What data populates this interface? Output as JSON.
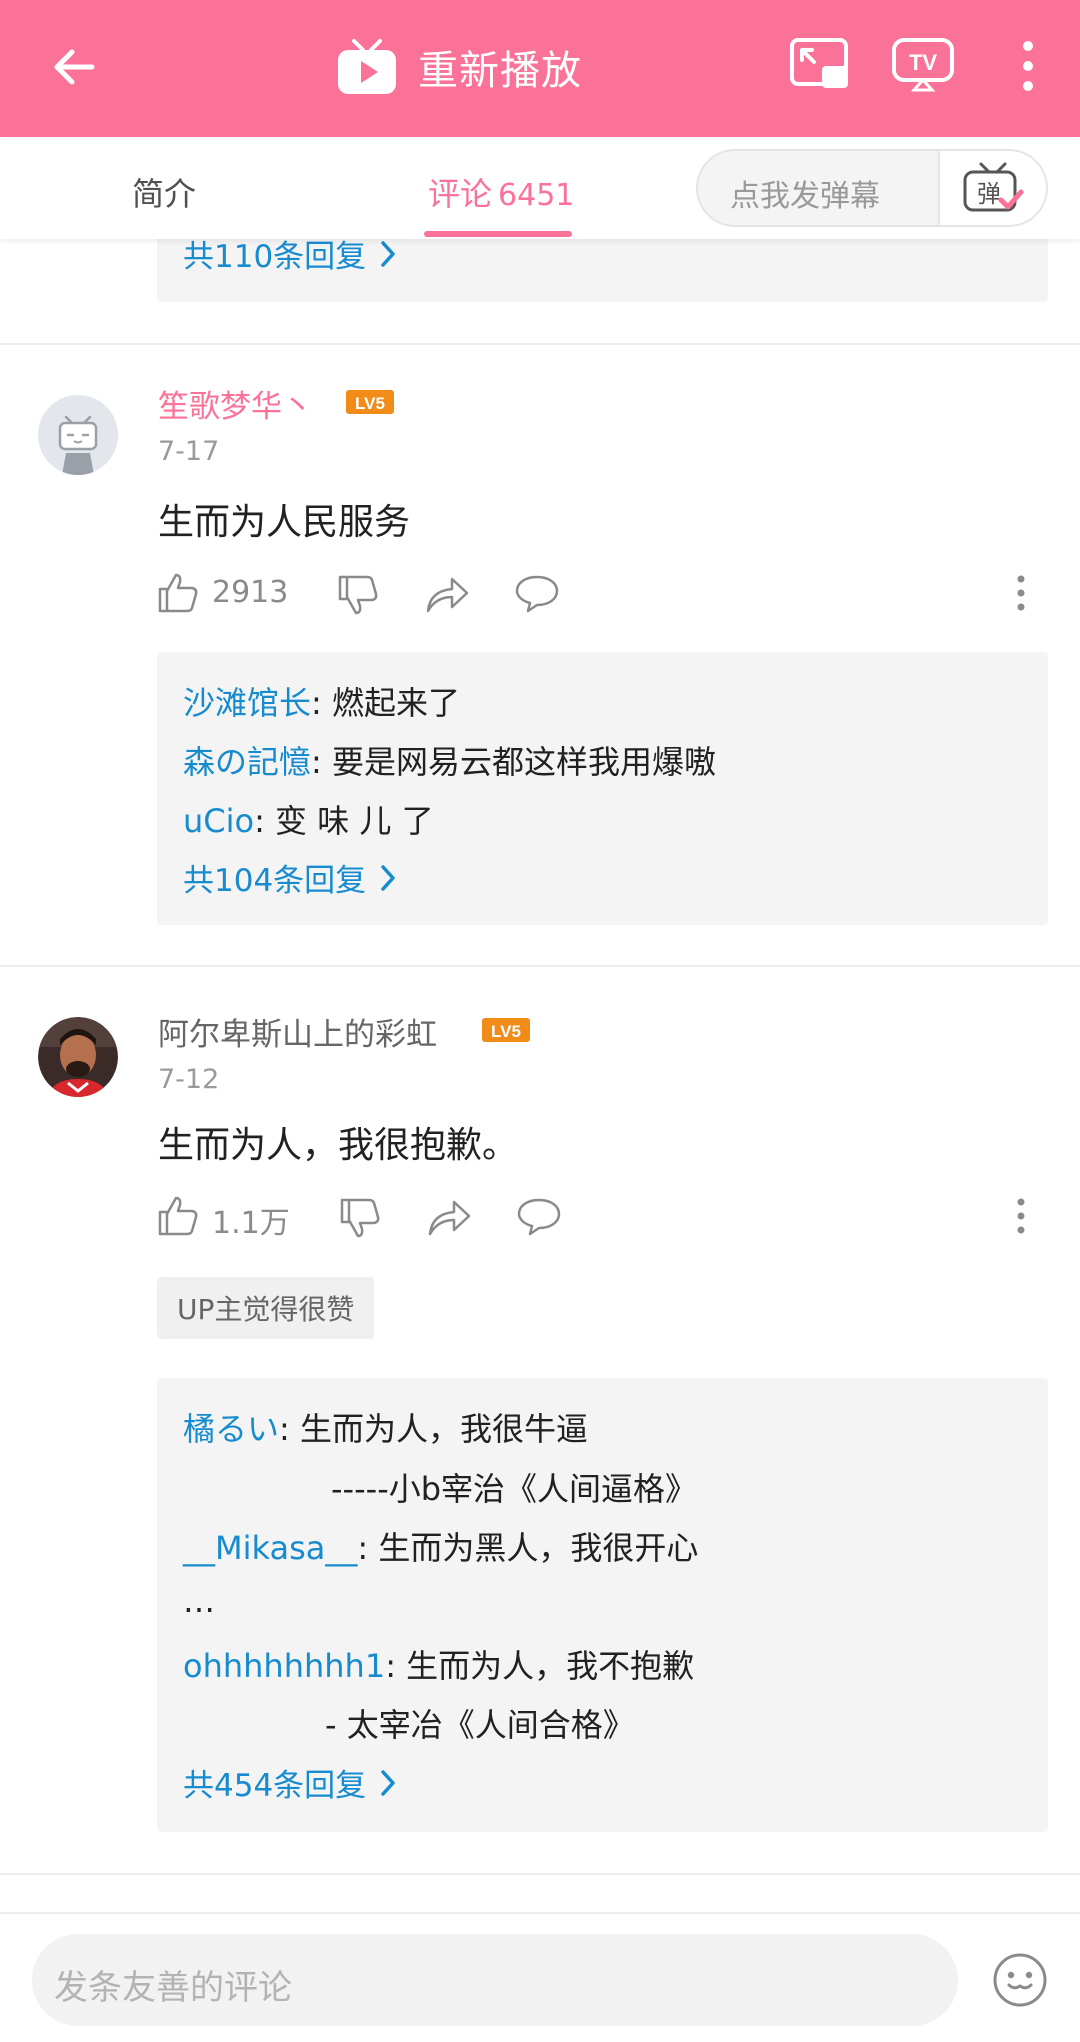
{
  "header": {
    "title": "重新播放"
  },
  "tabs": {
    "intro": "简介",
    "comment_label": "评论",
    "comment_count": "6451",
    "danmaku_placeholder": "点我发弹幕",
    "danmaku_button": "弹"
  },
  "partial_thread": {
    "more_replies": "共110条回复"
  },
  "comments": [
    {
      "username": "笙歌梦华丶",
      "level": "LV5",
      "date": "7-17",
      "content": "生而为人民服务",
      "likes": "2913",
      "replies": [
        {
          "user": "沙滩馆长",
          "text": ": 燃起来了"
        },
        {
          "user": "森の記憶",
          "text": ": 要是网易云都这样我用爆嗷"
        },
        {
          "user": "uCio",
          "text": ": 变 味 儿 了"
        }
      ],
      "more_replies": "共104条回复"
    },
    {
      "username": "阿尔卑斯山上的彩虹",
      "level": "LV5",
      "date": "7-12",
      "content": "生而为人，我很抱歉。",
      "likes": "1.1万",
      "up_badge": "UP主觉得很赞",
      "replies": [
        {
          "user": "橘るい",
          "text": ": 生而为人，我很牛逼"
        },
        {
          "user": "",
          "text": "-----小b宰治《人间逼格》"
        },
        {
          "user": "__Mikasa__",
          "text": ": 生而为黑人，我很开心"
        },
        {
          "user": "",
          "text": "…"
        },
        {
          "user": "ohhhhhhhh1",
          "text": ": 生而为人，我不抱歉"
        },
        {
          "user": "",
          "text": "- 太宰冶《人间合格》"
        }
      ],
      "more_replies": "共454条回复"
    }
  ],
  "bottom": {
    "input_placeholder": "发条友善的评论"
  },
  "colors": {
    "brand_pink": "#fb7299",
    "link_blue": "#178bcf",
    "level_orange": "#f28c18"
  }
}
